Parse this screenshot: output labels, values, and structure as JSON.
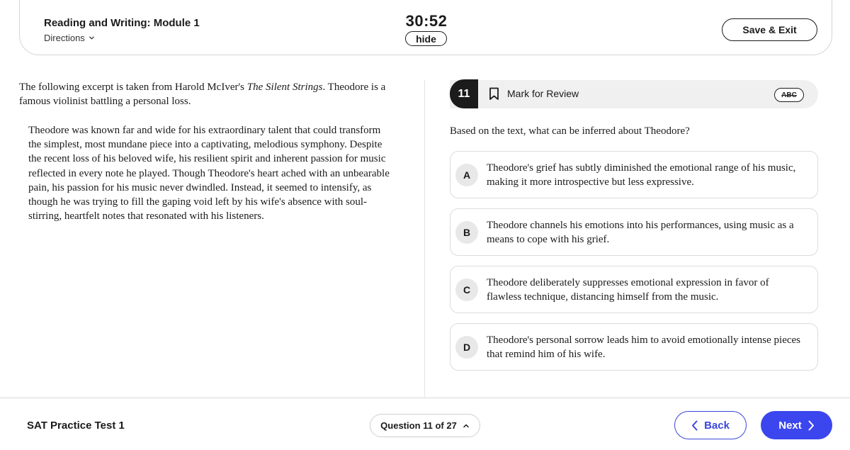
{
  "header": {
    "module_title": "Reading and Writing: Module 1",
    "directions_label": "Directions",
    "timer": "30:52",
    "hide_label": "hide",
    "save_exit_label": "Save & Exit"
  },
  "passage": {
    "intro_before": "The following excerpt is taken from Harold McIver's ",
    "intro_title": "The Silent Strings",
    "intro_after": ". Theodore is a famous violinist battling a personal loss.",
    "body": "Theodore was known far and wide for his extraordinary talent that could transform the simplest, most mundane piece into a captivating, melodious symphony. Despite the recent loss of his beloved wife, his resilient spirit and inherent passion for music reflected in every note he played. Though Theodore's heart ached with an unbearable pain, his passion for his music never dwindled. Instead, it seemed to intensify, as though he was trying to fill the gaping void left by his wife's absence with soul-stirring, heartfelt notes that resonated with his listeners."
  },
  "question": {
    "number": "11",
    "mark_for_review_label": "Mark for Review",
    "abc_label": "ABC",
    "prompt": "Based on the text, what can be inferred about Theodore?",
    "choices": [
      {
        "letter": "A",
        "text": "Theodore's grief has subtly diminished the emotional range of his music, making it more introspective but less expressive."
      },
      {
        "letter": "B",
        "text": "Theodore channels his emotions into his performances, using music as a means to cope with his grief."
      },
      {
        "letter": "C",
        "text": "Theodore deliberately suppresses emotional expression in favor of flawless technique, distancing himself from the music."
      },
      {
        "letter": "D",
        "text": "Theodore's personal sorrow leads him to avoid emotionally intense pieces that remind him of his wife."
      }
    ]
  },
  "footer": {
    "test_name": "SAT Practice Test 1",
    "question_nav_label": "Question 11 of 27",
    "back_label": "Back",
    "next_label": "Next"
  },
  "colors": {
    "accent": "#3b46ee",
    "dark": "#1b1b1b",
    "choice_border": "#dcdcdc"
  },
  "icons": [
    "chevron-down-icon",
    "bookmark-icon",
    "abc-strikethrough-icon",
    "chevron-up-icon",
    "chevron-left-icon",
    "chevron-right-icon"
  ]
}
